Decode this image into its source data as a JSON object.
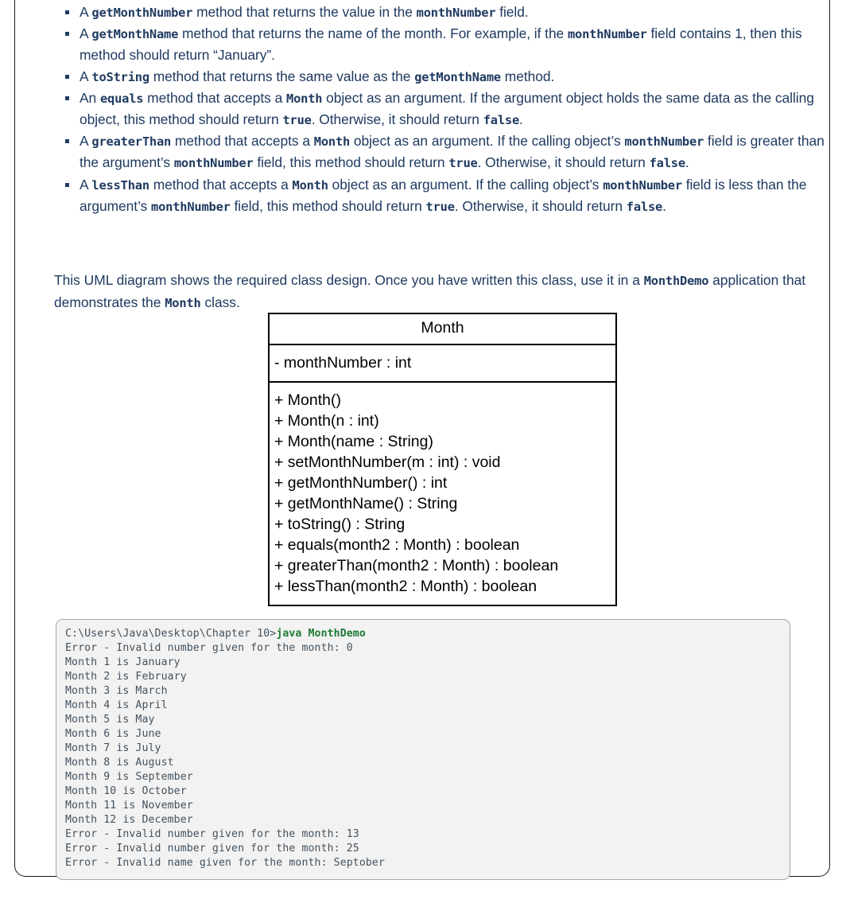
{
  "requirements": [
    {
      "id": "get-month-number",
      "segments": [
        {
          "t": "A ",
          "k": "text"
        },
        {
          "t": "getMonthNumber",
          "k": "code"
        },
        {
          "t": " method that returns the value in the ",
          "k": "text"
        },
        {
          "t": "monthNumber",
          "k": "code"
        },
        {
          "t": " field.",
          "k": "text"
        }
      ]
    },
    {
      "id": "get-month-name",
      "segments": [
        {
          "t": "A ",
          "k": "text"
        },
        {
          "t": "getMonthName",
          "k": "code"
        },
        {
          "t": " method that returns the name of the month. For example, if the ",
          "k": "text"
        },
        {
          "t": "monthNumber",
          "k": "code"
        },
        {
          "t": " field contains 1, then this method should return “January”.",
          "k": "text"
        }
      ]
    },
    {
      "id": "to-string",
      "segments": [
        {
          "t": "A ",
          "k": "text"
        },
        {
          "t": "toString",
          "k": "code"
        },
        {
          "t": " method that returns the same value as the ",
          "k": "text"
        },
        {
          "t": "getMonthName",
          "k": "code"
        },
        {
          "t": " method.",
          "k": "text"
        }
      ]
    },
    {
      "id": "equals",
      "segments": [
        {
          "t": "An ",
          "k": "text"
        },
        {
          "t": "equals",
          "k": "code"
        },
        {
          "t": " method that accepts a ",
          "k": "text"
        },
        {
          "t": "Month",
          "k": "code"
        },
        {
          "t": " object as an argument. If the argument object holds the same data as the calling object, this method should return ",
          "k": "text"
        },
        {
          "t": "true",
          "k": "code"
        },
        {
          "t": ". Otherwise, it should return ",
          "k": "text"
        },
        {
          "t": "false",
          "k": "code"
        },
        {
          "t": ".",
          "k": "text"
        }
      ]
    },
    {
      "id": "greater-than",
      "segments": [
        {
          "t": "A ",
          "k": "text"
        },
        {
          "t": "greaterThan",
          "k": "code"
        },
        {
          "t": " method that accepts a ",
          "k": "text"
        },
        {
          "t": "Month",
          "k": "code"
        },
        {
          "t": " object as an argument. If the calling object’s ",
          "k": "text"
        },
        {
          "t": "monthNumber",
          "k": "code"
        },
        {
          "t": " field is greater than the argument’s ",
          "k": "text"
        },
        {
          "t": "monthNumber",
          "k": "code"
        },
        {
          "t": " field, this method should return ",
          "k": "text"
        },
        {
          "t": "true",
          "k": "code"
        },
        {
          "t": ". Otherwise, it should return ",
          "k": "text"
        },
        {
          "t": "false",
          "k": "code"
        },
        {
          "t": ".",
          "k": "text"
        }
      ]
    },
    {
      "id": "less-than",
      "segments": [
        {
          "t": "A ",
          "k": "text"
        },
        {
          "t": "lessThan",
          "k": "code"
        },
        {
          "t": " method that accepts a ",
          "k": "text"
        },
        {
          "t": "Month",
          "k": "code"
        },
        {
          "t": " object as an argument. If the calling object’s ",
          "k": "text"
        },
        {
          "t": "monthNumber",
          "k": "code"
        },
        {
          "t": " field is less than the argument’s ",
          "k": "text"
        },
        {
          "t": "monthNumber",
          "k": "code"
        },
        {
          "t": " field, this method should return ",
          "k": "text"
        },
        {
          "t": "true",
          "k": "code"
        },
        {
          "t": ". Otherwise, it should return ",
          "k": "text"
        },
        {
          "t": "false",
          "k": "code"
        },
        {
          "t": ".",
          "k": "text"
        }
      ]
    }
  ],
  "uml_intro": {
    "segments": [
      {
        "t": "This UML diagram shows the required class design. Once you have written this class, use it in a ",
        "k": "text"
      },
      {
        "t": "MonthDemo",
        "k": "code"
      },
      {
        "t": " application that demonstrates the ",
        "k": "text"
      },
      {
        "t": "Month",
        "k": "code"
      },
      {
        "t": " class.",
        "k": "text"
      }
    ]
  },
  "uml": {
    "class_name": "Month",
    "attributes": [
      "- monthNumber : int"
    ],
    "operations": [
      "+ Month()",
      "+ Month(n : int)",
      "+ Month(name : String)",
      "+ setMonthNumber(m : int) : void",
      "+ getMonthNumber() : int",
      "+ getMonthName() : String",
      "+ toString() : String",
      "+ equals(month2 : Month) : boolean",
      "+ greaterThan(month2 : Month) : boolean",
      "+ lessThan(month2 : Month) : boolean"
    ]
  },
  "console": {
    "prompt_color": "#44525e",
    "command_color": "#1f7a34",
    "lines": [
      {
        "prefix": "C:\\Users\\Java\\Desktop\\Chapter 10>",
        "command": "java MonthDemo"
      },
      {
        "prefix": "Error - Invalid number given for the month: 0",
        "command": ""
      },
      {
        "prefix": "Month 1 is January",
        "command": ""
      },
      {
        "prefix": "Month 2 is February",
        "command": ""
      },
      {
        "prefix": "Month 3 is March",
        "command": ""
      },
      {
        "prefix": "Month 4 is April",
        "command": ""
      },
      {
        "prefix": "Month 5 is May",
        "command": ""
      },
      {
        "prefix": "Month 6 is June",
        "command": ""
      },
      {
        "prefix": "Month 7 is July",
        "command": ""
      },
      {
        "prefix": "Month 8 is August",
        "command": ""
      },
      {
        "prefix": "Month 9 is September",
        "command": ""
      },
      {
        "prefix": "Month 10 is October",
        "command": ""
      },
      {
        "prefix": "Month 11 is November",
        "command": ""
      },
      {
        "prefix": "Month 12 is December",
        "command": ""
      },
      {
        "prefix": "Error - Invalid number given for the month: 13",
        "command": ""
      },
      {
        "prefix": "Error - Invalid number given for the month: 25",
        "command": ""
      },
      {
        "prefix": "Error - Invalid name given for the month: Septober",
        "command": ""
      }
    ]
  }
}
